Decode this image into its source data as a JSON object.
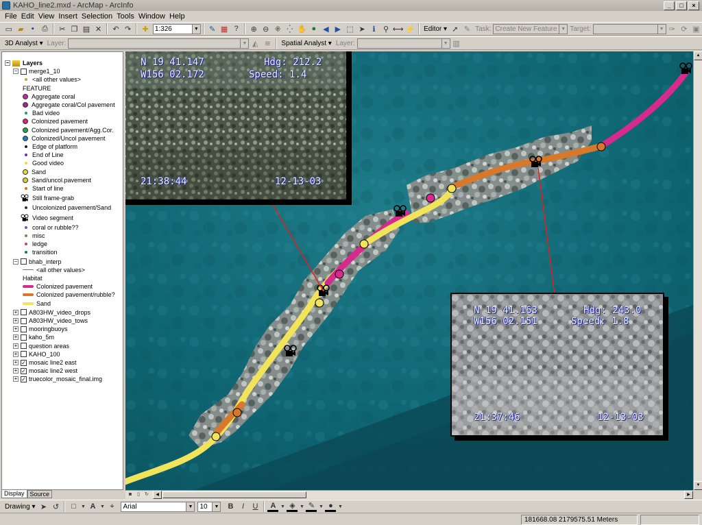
{
  "window": {
    "title": "KAHO_line2.mxd - ArcMap - ArcInfo",
    "controls": [
      "_",
      "□",
      "×"
    ]
  },
  "menu": [
    "File",
    "Edit",
    "View",
    "Insert",
    "Selection",
    "Tools",
    "Window",
    "Help"
  ],
  "standard_toolbar": {
    "scale": "1:326",
    "editor_label": "Editor ▾",
    "task_label": "Task:",
    "task_value": "Create New Feature",
    "target_label": "Target:"
  },
  "toolbar2": {
    "analyst_3d": "3D Analyst ▾",
    "layer_label": "Layer:",
    "spatial_analyst": "Spatial Analyst ▾",
    "layer_label2": "Layer:"
  },
  "toc": {
    "root": "Layers",
    "groups": [
      {
        "name": "merge1_10",
        "items": [
          {
            "label": "<all other values>",
            "color": "#c8a040",
            "kind": "tiny"
          },
          {
            "label": "FEATURE",
            "kind": "header"
          },
          {
            "label": "Aggregate coral",
            "color": "#c0309a",
            "kind": "dot"
          },
          {
            "label": "Aggregate coral/Col pavement",
            "color": "#a0288c",
            "kind": "dot"
          },
          {
            "label": "Bad video",
            "color": "#20a050",
            "kind": "tiny"
          },
          {
            "label": "Colonized pavement",
            "color": "#d82870",
            "kind": "dot"
          },
          {
            "label": "Colonized pavement/Agg.Cor.",
            "color": "#28a050",
            "kind": "dot"
          },
          {
            "label": "Colonized/Uncol pavement",
            "color": "#2878b8",
            "kind": "dot"
          },
          {
            "label": "Edge of platform",
            "color": "#202020",
            "kind": "tiny"
          },
          {
            "label": "End of Line",
            "color": "#7030a0",
            "kind": "tiny"
          },
          {
            "label": "Good video",
            "color": "#e8e040",
            "kind": "tiny"
          },
          {
            "label": "Sand",
            "color": "#e8d838",
            "kind": "dot"
          },
          {
            "label": "Sand/uncol.pavement",
            "color": "#d8d030",
            "kind": "dot"
          },
          {
            "label": "Start of line",
            "color": "#d07020",
            "kind": "tiny"
          },
          {
            "label": "Still frame-grab",
            "kind": "camera"
          },
          {
            "label": "Uncolonized pavement/Sand",
            "color": "#303030",
            "kind": "tiny"
          },
          {
            "label": "Video segment",
            "kind": "camera"
          },
          {
            "label": "coral or rubble??",
            "color": "#6060c0",
            "kind": "tiny"
          },
          {
            "label": "misc",
            "color": "#a07050",
            "kind": "tiny"
          },
          {
            "label": "ledge",
            "color": "#c04080",
            "kind": "tiny"
          },
          {
            "label": "transition",
            "color": "#207060",
            "kind": "tiny"
          }
        ]
      },
      {
        "name": "bhab_interp",
        "items": [
          {
            "label": "<all other values>",
            "color": "#c040a0",
            "kind": "thinline"
          },
          {
            "label": "Habitat",
            "kind": "header"
          },
          {
            "label": "Colonized pavement",
            "color": "#d62a8c",
            "kind": "line"
          },
          {
            "label": "Colonized pavement/rubble?",
            "color": "#d8782a",
            "kind": "line"
          },
          {
            "label": "Sand",
            "color": "#f2e45a",
            "kind": "line"
          }
        ]
      }
    ],
    "layers": [
      {
        "name": "A803HW_video_drops",
        "checked": false
      },
      {
        "name": "A803HW_video_tows",
        "checked": false
      },
      {
        "name": "mooringbuoys",
        "checked": false
      },
      {
        "name": "kaho_5m",
        "checked": false
      },
      {
        "name": "question areas",
        "checked": false
      },
      {
        "name": "KAHO_100",
        "checked": false
      },
      {
        "name": "mosaic line2 east",
        "checked": true
      },
      {
        "name": "mosaic line2 west",
        "checked": true
      },
      {
        "name": "truecolor_mosaic_final.img",
        "checked": true
      }
    ],
    "tabs": [
      "Display",
      "Source"
    ]
  },
  "frames": [
    {
      "lat": "N 19 41.147",
      "lon": "W156 02.172",
      "hdg": "Hdg: 212.2",
      "speed": "Speed: 1.4",
      "time": "21:38:44",
      "date": "12-13-03"
    },
    {
      "lat": "N 19 41.163",
      "lon": "W156 02.151",
      "hdg": "Hdg: 243.0",
      "speed": "Speed: 1.8",
      "time": "21:37:46",
      "date": "12-13-03"
    }
  ],
  "drawing_toolbar": {
    "drawing_label": "Drawing ▾",
    "font": "Arial",
    "size": "10",
    "bold": "B",
    "italic": "I",
    "underline": "U"
  },
  "status": {
    "coordinates": "181668.08  2179575.51 Meters"
  },
  "colors": {
    "sand": "#f2e45a",
    "colonized_pavement": "#d62a8c",
    "colonized_rubble": "#d8782a",
    "water": "#0d6470",
    "arrow": "#e02020"
  }
}
